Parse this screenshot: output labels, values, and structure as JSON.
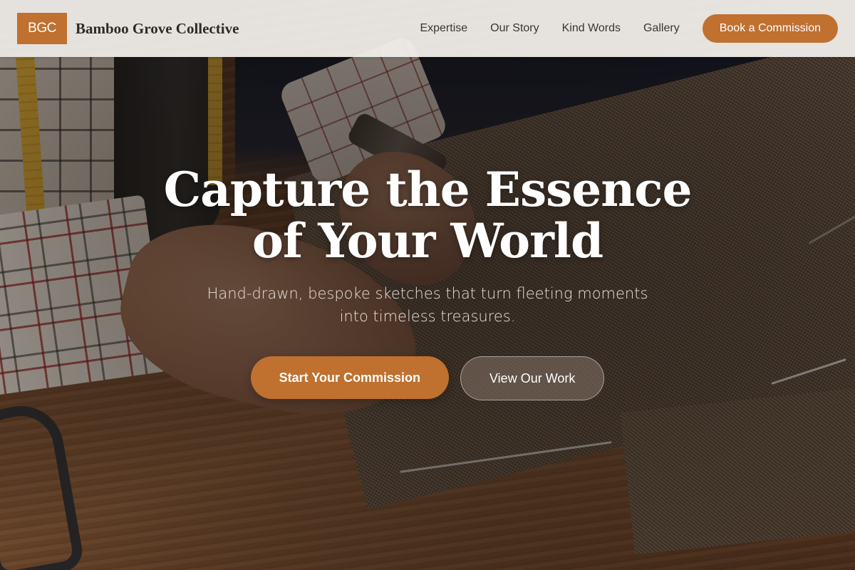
{
  "header": {
    "logo_text": "BGC",
    "brand_name": "Bamboo Grove Collective",
    "nav": [
      "Expertise",
      "Our Story",
      "Kind Words",
      "Gallery"
    ],
    "cta_label": "Book a Commission"
  },
  "hero": {
    "title_line1": "Capture the Essence",
    "title_line2": "of Your World",
    "subtitle": "Hand-drawn, bespoke sketches that turn fleeting moments into timeless treasures.",
    "primary_label": "Start Your Commission",
    "secondary_label": "View Our Work",
    "background_image": "tailor-cutting-fabric-photo"
  },
  "colors": {
    "accent": "#c0702f",
    "header_bg": "#f3f1ee",
    "brand_text": "#2d2b26"
  }
}
